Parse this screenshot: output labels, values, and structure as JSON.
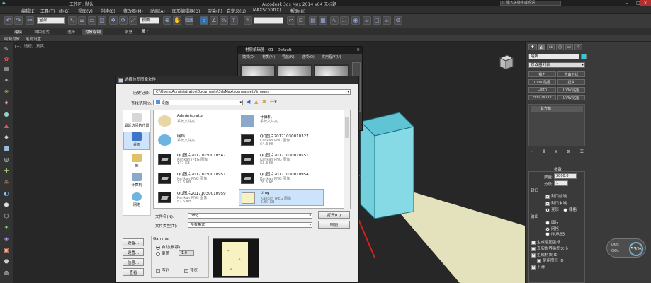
{
  "window": {
    "title": "Autodesk 3ds Max  2014 x64     无标题",
    "controls": [
      "minimize-icon",
      "maximize-icon",
      "close-icon"
    ]
  },
  "menubar": {
    "items": [
      "编辑(E)",
      "工具(T)",
      "组(G)",
      "视图(V)",
      "创建(C)",
      "修改器(M)",
      "动画(A)",
      "图形编辑器(D)",
      "渲染(R)",
      "自定义(U)",
      "MAXScript(X)",
      "帮助(H)"
    ],
    "workspace": "工作区: 默认",
    "search_placeholder": "键入关键字或短语"
  },
  "toolbar": {
    "selection_filter": "全部",
    "view_dropdown": "视图"
  },
  "ribbon": {
    "tabs": [
      "建模",
      "自由形式",
      "选择",
      "对象绘制",
      "填充"
    ],
    "active_tab": "对象绘制",
    "subtabs": [
      "绘制对象",
      "笔刷设置"
    ]
  },
  "viewport": {
    "label": "[+] [透视] [真实]"
  },
  "material_editor": {
    "title": "材质编辑器 - 01 - Default",
    "menu": [
      "模式(D)",
      "材质(M)",
      "导航(N)",
      "选项(O)",
      "实用程序(U)"
    ]
  },
  "dialog": {
    "title": "选择位图图像文件",
    "history_label": "历史记录:",
    "history_value": "C:\\Users\\Administrator\\Documents\\3dsMax\\sceneassets\\images",
    "lookin_label": "查找范围(I):",
    "lookin_value": "桌面",
    "places": [
      {
        "label": "最近访问的位置"
      },
      {
        "label": "桌面"
      },
      {
        "label": "库"
      },
      {
        "label": "计算机"
      },
      {
        "label": "网络"
      }
    ],
    "files": [
      {
        "name": "Administrator",
        "type": "系统文件夹",
        "size": ""
      },
      {
        "name": "计算机",
        "type": "系统文件夹",
        "size": ""
      },
      {
        "name": "网络",
        "type": "系统文件夹",
        "size": ""
      },
      {
        "name": "QQ图片20171030010327",
        "type": "Kankan PNG 图像",
        "size": "64.3 KB"
      },
      {
        "name": "QQ图片20171030010547",
        "type": "Kankan JPEG 图像",
        "size": "147 KB"
      },
      {
        "name": "QQ图片20171030010551",
        "type": "Kankan PNG 图像",
        "size": "63.3 KB"
      },
      {
        "name": "QQ图片20171030010951",
        "type": "Kankan PNG 图像",
        "size": "77.6 KB"
      },
      {
        "name": "QQ图片20171030010954",
        "type": "Kankan PNG 图像",
        "size": "76.6 KB"
      },
      {
        "name": "QQ图片20171030010959",
        "type": "Kankan PNG 图像",
        "size": "87.6 KB"
      },
      {
        "name": "timg",
        "type": "Kankan JPEG 图像",
        "size": "5.60 KB"
      }
    ],
    "filename_label": "文件名(N):",
    "filename_value": "timg",
    "filetype_label": "文件类型(T):",
    "filetype_value": "所有格式",
    "open_button": "打开(O)",
    "cancel_button": "取消",
    "left_buttons": [
      "设备...",
      "设置...",
      "信息...",
      "查看"
    ],
    "gamma_title": "Gamma",
    "gamma_options": [
      "自动(推荐)",
      "覆盖"
    ],
    "gamma_value": "1.0",
    "sequence_label": "序列",
    "preview_label": "预览"
  },
  "command_panel": {
    "tabs": [
      "create-icon",
      "modify-icon",
      "hierarchy-icon",
      "motion-icon",
      "display-icon",
      "utilities-icon"
    ],
    "object_name": "踏脚",
    "modifier_list": "修改器列表",
    "buttons": [
      "推力",
      "弯曲形状",
      "UVW 贴图",
      "扭曲",
      "壳",
      "Cloth",
      "UVW 贴图",
      "FFD 2x2x2",
      "UVW 贴图"
    ],
    "stack_item": "长方体",
    "rollout_title": "参数",
    "amount_label": "数量:",
    "amount_value": "3000.0",
    "segments_label": "分段:",
    "segments_value": "1",
    "capping_title": "封口",
    "cap_start": "封口始端",
    "cap_end": "封口末端",
    "morph": "变形",
    "grid": "栅格",
    "output_title": "输出",
    "output_options": [
      "面片",
      "网格",
      "NURBS"
    ],
    "gen_mapping": "生成贴图坐标",
    "real_world": "真实世界贴图大小",
    "gen_material_ids": "生成材质 ID",
    "use_shape_ids": "使用图形 ID",
    "smooth": "平滑"
  },
  "progress": {
    "percent": "55%",
    "up": "0K/s",
    "down": "0K/s"
  }
}
